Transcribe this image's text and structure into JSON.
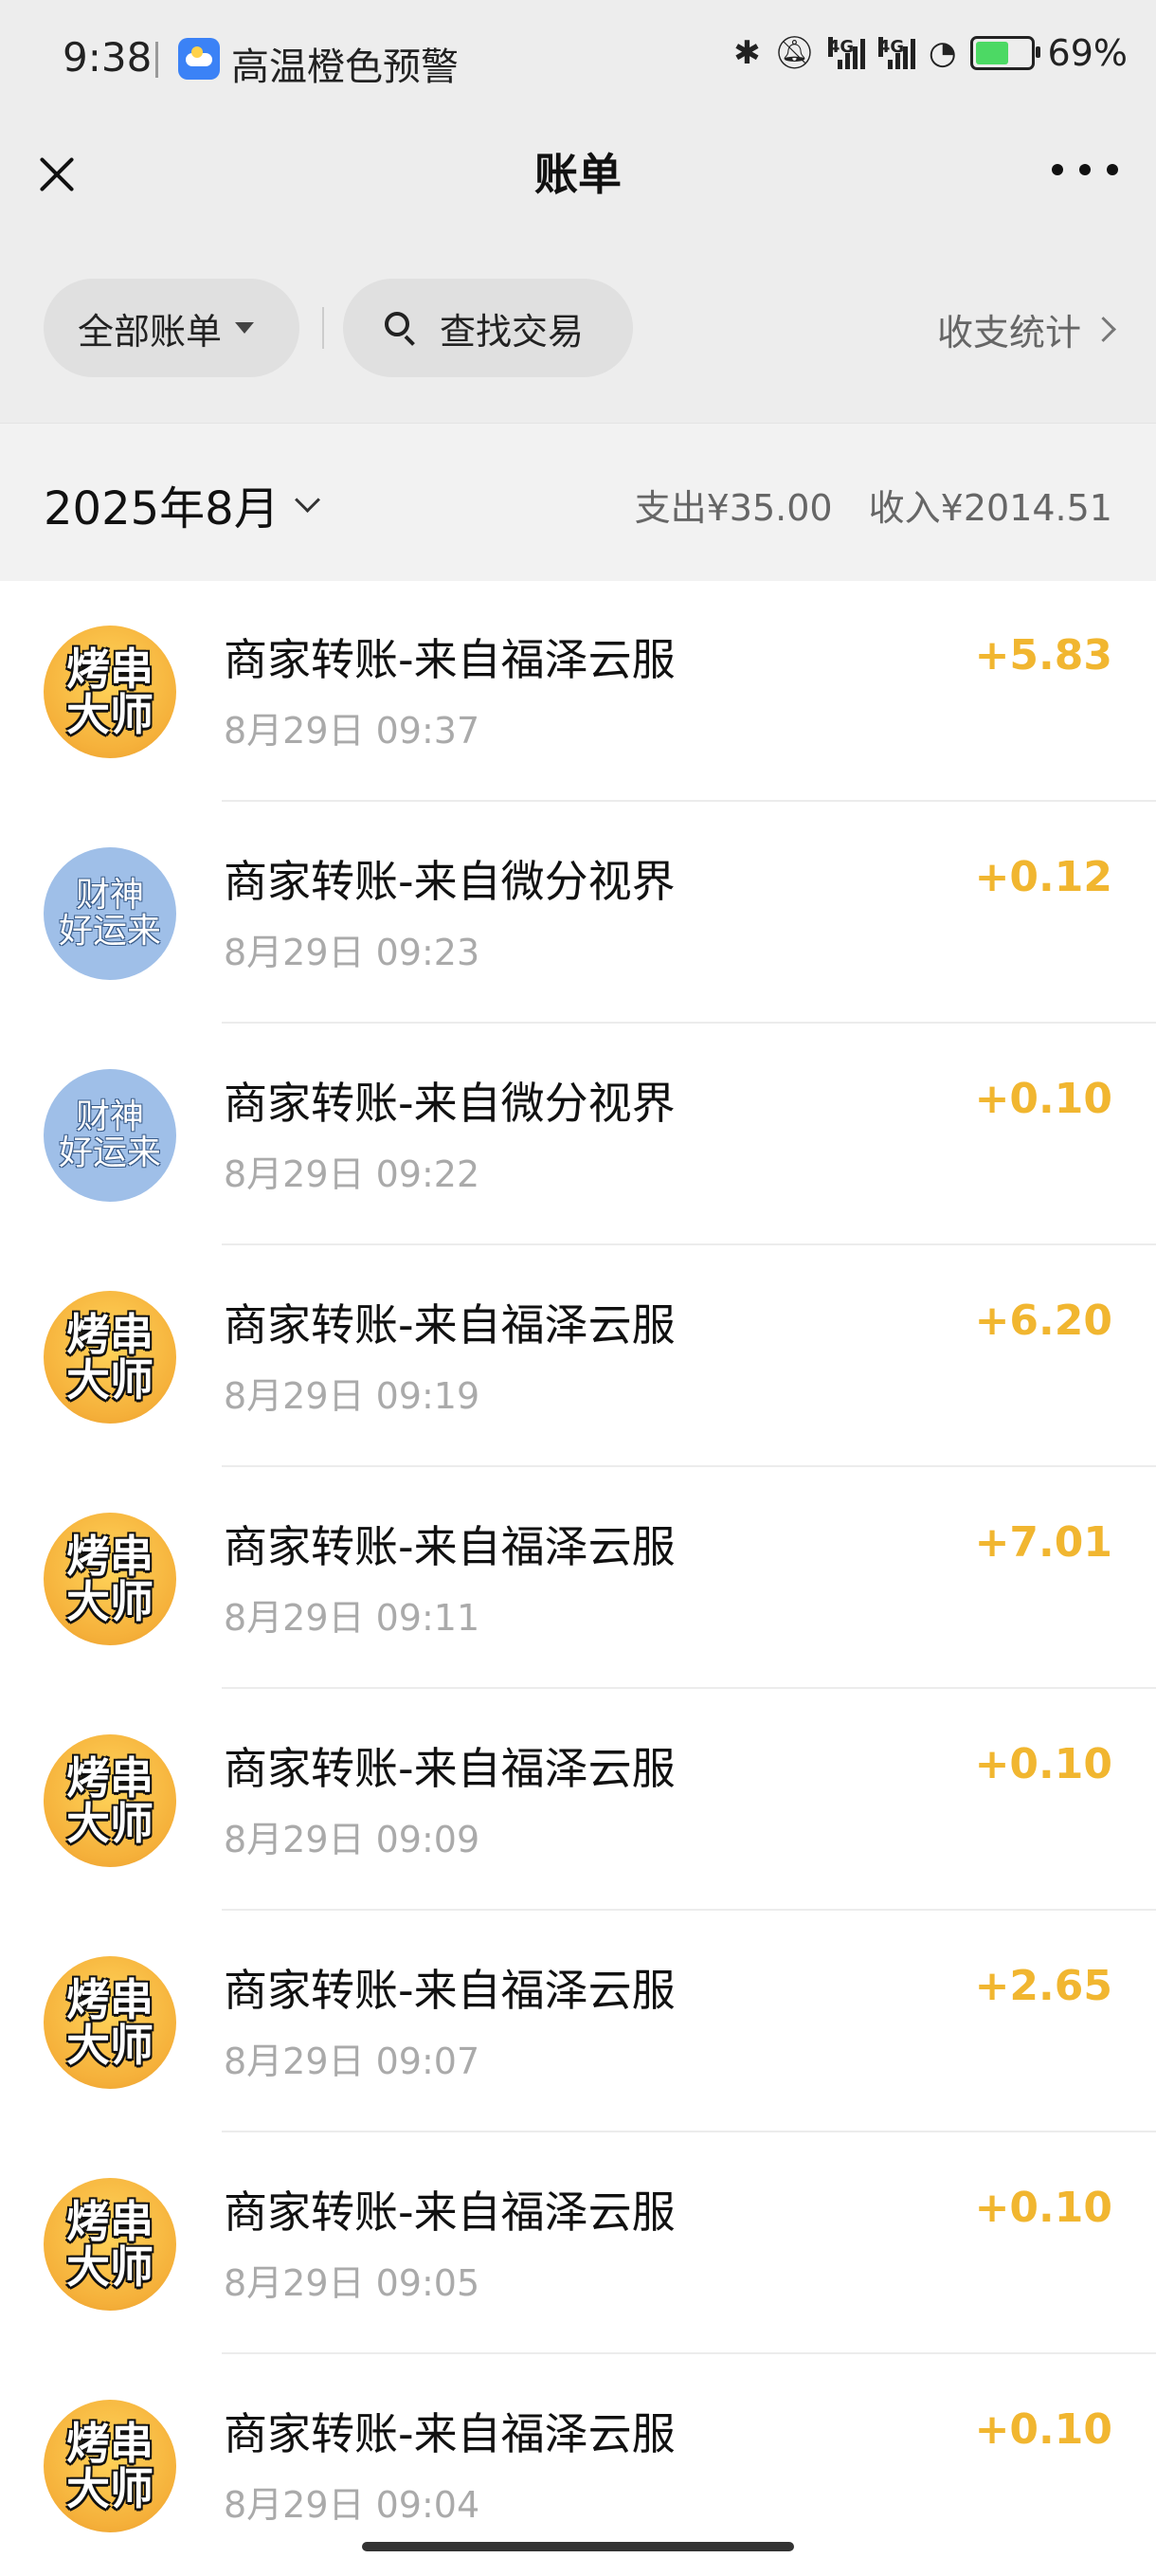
{
  "status_bar": {
    "time": "9:38",
    "alert_text": "高温橙色预警",
    "network_1": "4G",
    "network_2": "4G",
    "battery_percent": "69%",
    "icons": [
      "weather-icon",
      "bluetooth-icon",
      "bell-off-icon",
      "signal-icon",
      "signal-icon",
      "wifi-icon",
      "battery-icon"
    ]
  },
  "nav": {
    "title": "账单",
    "close_icon": "close-icon",
    "more_icon": "more-icon"
  },
  "filters": {
    "all_bills_label": "全部账单",
    "search_label": "查找交易",
    "stats_label": "收支统计"
  },
  "month": {
    "label": "2025年8月",
    "expense": "支出¥35.00",
    "income": "收入¥2014.51"
  },
  "colors": {
    "amount": "#f1b630",
    "background_header": "#ededed",
    "avatar_orange": "#f5b03a",
    "avatar_blue": "#9fbfe8"
  },
  "transactions": [
    {
      "title": "商家转账-来自福泽云服",
      "date": "8月29日 09:37",
      "amount": "+5.83",
      "avatar_line1": "烤串",
      "avatar_line2": "大师",
      "avatar_style": "orange"
    },
    {
      "title": "商家转账-来自微分视界",
      "date": "8月29日 09:23",
      "amount": "+0.12",
      "avatar_line1": "财神",
      "avatar_line2": "好运来",
      "avatar_style": "blue"
    },
    {
      "title": "商家转账-来自微分视界",
      "date": "8月29日 09:22",
      "amount": "+0.10",
      "avatar_line1": "财神",
      "avatar_line2": "好运来",
      "avatar_style": "blue"
    },
    {
      "title": "商家转账-来自福泽云服",
      "date": "8月29日 09:19",
      "amount": "+6.20",
      "avatar_line1": "烤串",
      "avatar_line2": "大师",
      "avatar_style": "orange"
    },
    {
      "title": "商家转账-来自福泽云服",
      "date": "8月29日 09:11",
      "amount": "+7.01",
      "avatar_line1": "烤串",
      "avatar_line2": "大师",
      "avatar_style": "orange"
    },
    {
      "title": "商家转账-来自福泽云服",
      "date": "8月29日 09:09",
      "amount": "+0.10",
      "avatar_line1": "烤串",
      "avatar_line2": "大师",
      "avatar_style": "orange"
    },
    {
      "title": "商家转账-来自福泽云服",
      "date": "8月29日 09:07",
      "amount": "+2.65",
      "avatar_line1": "烤串",
      "avatar_line2": "大师",
      "avatar_style": "orange"
    },
    {
      "title": "商家转账-来自福泽云服",
      "date": "8月29日 09:05",
      "amount": "+0.10",
      "avatar_line1": "烤串",
      "avatar_line2": "大师",
      "avatar_style": "orange"
    },
    {
      "title": "商家转账-来自福泽云服",
      "date": "8月29日 09:04",
      "amount": "+0.10",
      "avatar_line1": "烤串",
      "avatar_line2": "大师",
      "avatar_style": "orange"
    }
  ]
}
